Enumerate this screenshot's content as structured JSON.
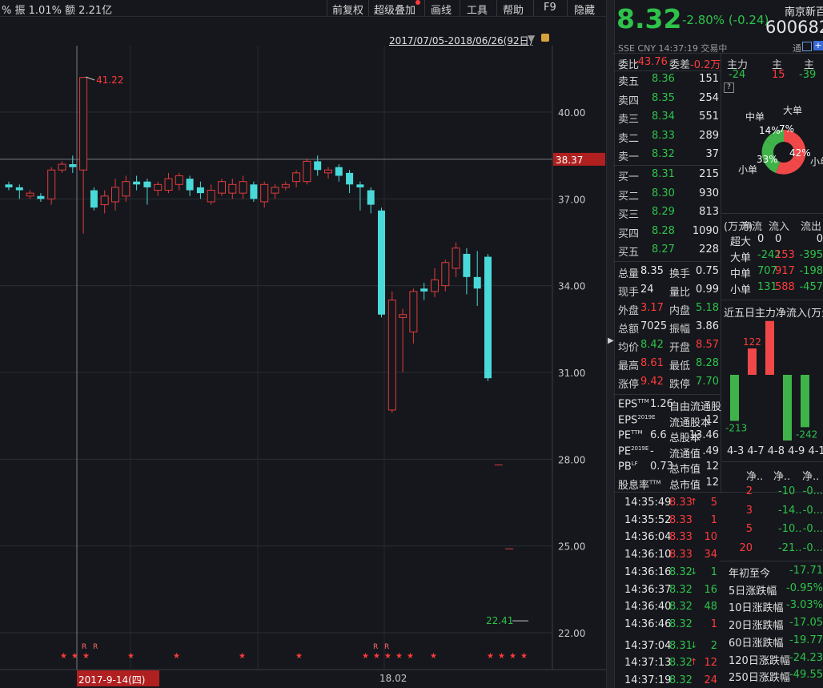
{
  "header": {
    "left_stats": "%  振 1.01%  额 2.21亿",
    "menu": [
      "前复权",
      "超级叠加",
      "画线",
      "工具",
      "帮助",
      "F9",
      "隐藏"
    ],
    "date_range": "2017/07/05-2018/06/26(92日)"
  },
  "chart_data": {
    "type": "candlestick",
    "y_ticks": [
      "40.00",
      "37.00",
      "34.00",
      "31.00",
      "28.00",
      "25.00",
      "22.00"
    ],
    "y_range": [
      21.5,
      42.3
    ],
    "current_price_label": "38.37",
    "high_marker": "41.22",
    "low_marker": "22.41",
    "x_labels": [
      "2017-9-14(四)",
      "18.02"
    ],
    "candles": [
      {
        "o": 37.5,
        "c": 37.4,
        "h": 37.6,
        "l": 37.3
      },
      {
        "o": 37.4,
        "c": 37.3,
        "h": 37.5,
        "l": 37.0
      },
      {
        "o": 37.1,
        "c": 37.2,
        "h": 37.3,
        "l": 37.0
      },
      {
        "o": 37.1,
        "c": 37.0,
        "h": 37.2,
        "l": 36.9
      },
      {
        "o": 37.0,
        "c": 38.0,
        "h": 38.1,
        "l": 36.8
      },
      {
        "o": 38.0,
        "c": 38.2,
        "h": 38.3,
        "l": 37.9
      },
      {
        "o": 38.2,
        "c": 38.1,
        "h": 38.5,
        "l": 37.9
      },
      {
        "o": 38.0,
        "c": 41.2,
        "h": 41.22,
        "l": 35.8
      },
      {
        "o": 37.3,
        "c": 36.7,
        "h": 37.4,
        "l": 36.6
      },
      {
        "o": 36.8,
        "c": 37.1,
        "h": 37.3,
        "l": 36.5
      },
      {
        "o": 36.9,
        "c": 37.4,
        "h": 37.7,
        "l": 36.6
      },
      {
        "o": 37.1,
        "c": 37.6,
        "h": 37.8,
        "l": 36.9
      },
      {
        "o": 37.6,
        "c": 37.5,
        "h": 37.8,
        "l": 37.3
      },
      {
        "o": 37.6,
        "c": 37.4,
        "h": 37.7,
        "l": 36.8
      },
      {
        "o": 37.3,
        "c": 37.5,
        "h": 37.6,
        "l": 37.1
      },
      {
        "o": 37.3,
        "c": 37.7,
        "h": 37.9,
        "l": 37.2
      },
      {
        "o": 37.5,
        "c": 37.8,
        "h": 37.9,
        "l": 37.3
      },
      {
        "o": 37.7,
        "c": 37.3,
        "h": 37.8,
        "l": 37.1
      },
      {
        "o": 37.4,
        "c": 37.2,
        "h": 37.6,
        "l": 37.0
      },
      {
        "o": 36.9,
        "c": 37.3,
        "h": 37.5,
        "l": 36.8
      },
      {
        "o": 37.2,
        "c": 37.6,
        "h": 37.7,
        "l": 37.1
      },
      {
        "o": 37.2,
        "c": 37.5,
        "h": 37.7,
        "l": 37.0
      },
      {
        "o": 37.2,
        "c": 37.6,
        "h": 37.8,
        "l": 37.0
      },
      {
        "o": 37.5,
        "c": 37.0,
        "h": 37.6,
        "l": 36.9
      },
      {
        "o": 36.9,
        "c": 37.5,
        "h": 37.6,
        "l": 36.7
      },
      {
        "o": 37.2,
        "c": 37.4,
        "h": 37.5,
        "l": 37.0
      },
      {
        "o": 37.4,
        "c": 37.5,
        "h": 37.6,
        "l": 37.3
      },
      {
        "o": 37.6,
        "c": 37.9,
        "h": 38.0,
        "l": 37.4
      },
      {
        "o": 37.6,
        "c": 38.3,
        "h": 38.4,
        "l": 37.5
      },
      {
        "o": 38.3,
        "c": 38.0,
        "h": 38.5,
        "l": 37.8
      },
      {
        "o": 37.9,
        "c": 38.0,
        "h": 38.1,
        "l": 37.7
      },
      {
        "o": 38.1,
        "c": 37.8,
        "h": 38.2,
        "l": 37.6
      },
      {
        "o": 37.9,
        "c": 37.5,
        "h": 38.0,
        "l": 37.2
      },
      {
        "o": 37.5,
        "c": 37.4,
        "h": 37.6,
        "l": 36.6
      },
      {
        "o": 37.3,
        "c": 36.8,
        "h": 37.4,
        "l": 36.5
      },
      {
        "o": 36.6,
        "c": 33.0,
        "h": 36.7,
        "l": 32.9
      },
      {
        "o": 29.7,
        "c": 33.5,
        "h": 33.8,
        "l": 29.6
      },
      {
        "o": 32.9,
        "c": 33.0,
        "h": 33.2,
        "l": 31.0
      },
      {
        "o": 32.4,
        "c": 33.8,
        "h": 33.9,
        "l": 32.0
      },
      {
        "o": 33.9,
        "c": 33.8,
        "h": 34.1,
        "l": 33.5
      },
      {
        "o": 33.8,
        "c": 34.2,
        "h": 34.6,
        "l": 33.6
      },
      {
        "o": 34.0,
        "c": 34.8,
        "h": 34.9,
        "l": 33.8
      },
      {
        "o": 34.6,
        "c": 35.3,
        "h": 35.5,
        "l": 34.3
      },
      {
        "o": 35.1,
        "c": 34.3,
        "h": 35.3,
        "l": 33.7
      },
      {
        "o": 34.3,
        "c": 33.9,
        "h": 35.2,
        "l": 33.3
      },
      {
        "o": 35.0,
        "c": 30.8,
        "h": 35.1,
        "l": 30.7
      },
      {
        "o": 27.8,
        "c": 27.8,
        "h": 27.8,
        "l": 27.8
      },
      {
        "o": 24.9,
        "c": 24.9,
        "h": 24.9,
        "l": 24.9
      }
    ]
  },
  "quote": {
    "price": "8.32",
    "change": "-2.80% (-0.24)",
    "name": "南京新百",
    "code": "600682",
    "exchange_line": "SSE   CNY   14:37:19   交易中",
    "tong": "通"
  },
  "orderbook": {
    "weibi_label": "委比",
    "weibi_value": "-43.76",
    "weicha_label": "委差",
    "weicha_value": "-0.2万",
    "asks": [
      {
        "label": "卖五",
        "price": "8.36",
        "vol": "151"
      },
      {
        "label": "卖四",
        "price": "8.35",
        "vol": "254"
      },
      {
        "label": "卖三",
        "price": "8.34",
        "vol": "551"
      },
      {
        "label": "卖二",
        "price": "8.33",
        "vol": "289"
      },
      {
        "label": "卖一",
        "price": "8.32",
        "vol": "37"
      }
    ],
    "bids": [
      {
        "label": "买一",
        "price": "8.31",
        "vol": "215"
      },
      {
        "label": "买二",
        "price": "8.30",
        "vol": "930"
      },
      {
        "label": "买三",
        "price": "8.29",
        "vol": "813"
      },
      {
        "label": "买四",
        "price": "8.28",
        "vol": "1090"
      },
      {
        "label": "买五",
        "price": "8.27",
        "vol": "228"
      }
    ]
  },
  "stats": [
    {
      "l1": "总量",
      "v1": "8.35",
      "l2": "换手",
      "v2": "0.75",
      "c1": "white",
      "c2": "white"
    },
    {
      "l1": "现手",
      "v1": "24",
      "l2": "量比",
      "v2": "0.99",
      "c1": "white",
      "c2": "white"
    },
    {
      "l1": "外盘",
      "v1": "3.17",
      "l2": "内盘",
      "v2": "5.18",
      "c1": "red",
      "c2": "green"
    },
    {
      "l1": "总额",
      "v1": "7025",
      "l2": "振幅",
      "v2": "3.86",
      "c1": "white",
      "c2": "white"
    },
    {
      "l1": "均价",
      "v1": "8.42",
      "l2": "开盘",
      "v2": "8.57",
      "c1": "green",
      "c2": "red"
    },
    {
      "l1": "最高",
      "v1": "8.61",
      "l2": "最低",
      "v2": "8.28",
      "c1": "red",
      "c2": "green"
    },
    {
      "l1": "涨停",
      "v1": "9.42",
      "l2": "跌停",
      "v2": "7.70",
      "c1": "red",
      "c2": "green"
    }
  ],
  "fundamentals": [
    {
      "l1": "EPS",
      "s1": "TTM",
      "v1": "1.26",
      "l2": "自由流通股",
      "v2": ""
    },
    {
      "l1": "EPS",
      "s1": "2019E",
      "v1": "",
      "l2": "流通股本",
      "v2": "12"
    },
    {
      "l1": "PE",
      "s1": "TTM",
      "v1": "6.6",
      "l2": "总股本",
      "v2": "13.46"
    },
    {
      "l1": "PE",
      "s1": "2019E",
      "v1": "-",
      "l2": "流通值",
      "v2": ".49"
    },
    {
      "l1": "PB",
      "s1": "LF",
      "v1": "0.73",
      "l2": "总市值",
      "v2": "12"
    },
    {
      "l1": "股息率",
      "s1": "TTM",
      "v1": "",
      "l2": "总市值",
      "v2": "12"
    }
  ],
  "ticks": [
    {
      "time": "14:35:49",
      "price": "8.33",
      "arrow": "up",
      "vol": "5",
      "vc": "red"
    },
    {
      "time": "14:35:52",
      "price": "8.33",
      "arrow": "",
      "vol": "1",
      "vc": "red"
    },
    {
      "time": "14:36:04",
      "price": "8.33",
      "arrow": "",
      "vol": "10",
      "vc": "red"
    },
    {
      "time": "14:36:10",
      "price": "8.33",
      "arrow": "",
      "vol": "34",
      "vc": "red"
    },
    {
      "time": "14:36:16",
      "price": "8.32",
      "arrow": "down",
      "vol": "1",
      "vc": "green"
    },
    {
      "time": "14:36:37",
      "price": "8.32",
      "arrow": "",
      "vol": "16",
      "vc": "green"
    },
    {
      "time": "14:36:40",
      "price": "8.32",
      "arrow": "",
      "vol": "48",
      "vc": "green"
    },
    {
      "time": "14:36:46",
      "price": "8.32",
      "arrow": "",
      "vol": "1",
      "vc": "red"
    },
    {
      "time": "14:37:04",
      "price": "8.31",
      "arrow": "down",
      "vol": "2",
      "vc": "green"
    },
    {
      "time": "14:37:13",
      "price": "8.32",
      "arrow": "up",
      "vol": "12",
      "vc": "red"
    },
    {
      "time": "14:37:19",
      "price": "8.32",
      "arrow": "",
      "vol": "24",
      "vc": "red"
    }
  ],
  "flow": {
    "headers": [
      "主力",
      "主",
      "主"
    ],
    "values": [
      "-24",
      "15",
      "-39"
    ],
    "q": "?",
    "pie": {
      "labels": [
        "大单",
        "中单",
        "小单",
        "小单"
      ],
      "pct": [
        "7%",
        "14%",
        "33%",
        "42%"
      ]
    },
    "table_headers": [
      "(万元)",
      "流入",
      "流出"
    ],
    "table_header_extra": "净流",
    "rows": [
      {
        "label": "超大",
        "net": "0",
        "in": "0",
        "out": "0",
        "nc": "white"
      },
      {
        "label": "大单",
        "net": "-242",
        "in": "153",
        "out": "-395",
        "nc": "green"
      },
      {
        "label": "中单",
        "net": "707",
        "in": "917",
        "out": "-198",
        "nc": "green"
      },
      {
        "label": "小单",
        "net": "131",
        "in": "588",
        "out": "-457",
        "nc": "green"
      }
    ],
    "five_day_title": "近五日主力净流入(万元)",
    "five_day_bars": [
      {
        "v": -213,
        "label": "-213"
      },
      {
        "v": 122,
        "label": "122"
      },
      {
        "v": 249,
        "label": "249"
      },
      {
        "v": -333,
        "label": "-333"
      },
      {
        "v": -242,
        "label": "-242"
      }
    ],
    "five_day_dates": "4-3  4-7  4-8  4-9  4-10",
    "net_headers": [
      "净..",
      "净..",
      "净.."
    ],
    "net_rows": [
      {
        "a": "2",
        "b": "-10",
        "c": "-0..."
      },
      {
        "a": "3",
        "b": "-14..",
        "c": "-0..."
      },
      {
        "a": "5",
        "b": "-10..",
        "c": "-0..."
      },
      {
        "a": "20",
        "b": "-21..",
        "c": "-0..."
      }
    ]
  },
  "changes": [
    {
      "label": "年初至今",
      "value": "-17.71"
    },
    {
      "label": "5日涨跌幅",
      "value": "-0.95%"
    },
    {
      "label": "10日涨跌幅",
      "value": "-3.03%"
    },
    {
      "label": "20日涨跌幅",
      "value": "-17.05"
    },
    {
      "label": "60日涨跌幅",
      "value": "-19.77"
    },
    {
      "label": "120日涨跌幅",
      "value": "-24.23"
    },
    {
      "label": "250日涨跌幅",
      "value": "-49.55"
    }
  ],
  "colors": {
    "up": "#e03c3c",
    "down": "#4ad9d9",
    "grid": "#2e3138",
    "accent": "#ff3b3b"
  }
}
